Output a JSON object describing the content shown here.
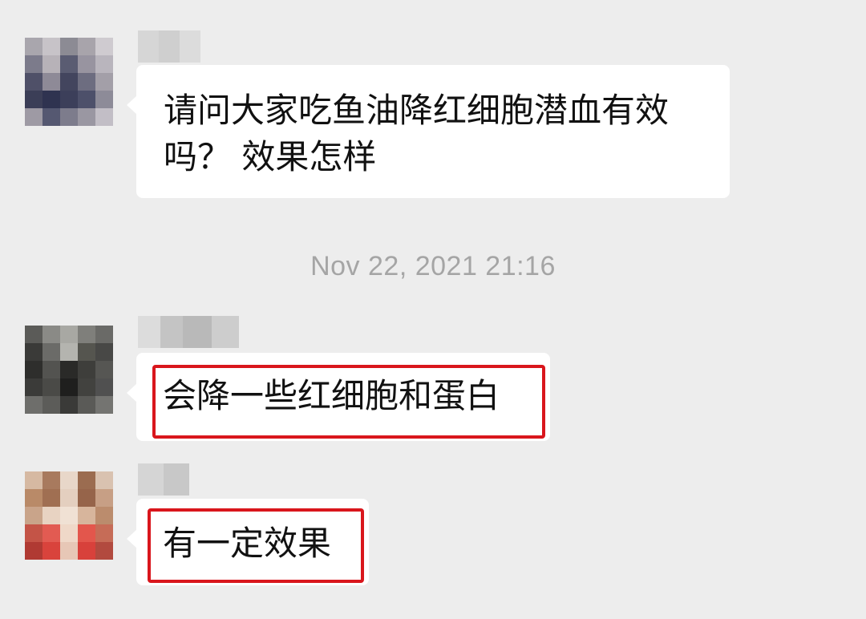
{
  "messages": [
    {
      "text": "请问大家吃鱼油降红细胞潜血有效\n吗？ 效果怎样"
    },
    {
      "text": "会降一些红细胞和蛋白"
    },
    {
      "text": "有一定效果"
    }
  ],
  "timestamp": "Nov 22, 2021 21:16",
  "colors": {
    "background": "#ededed",
    "bubble": "#ffffff",
    "highlight": "#d9161c",
    "timestamp": "#a5a5a5"
  }
}
